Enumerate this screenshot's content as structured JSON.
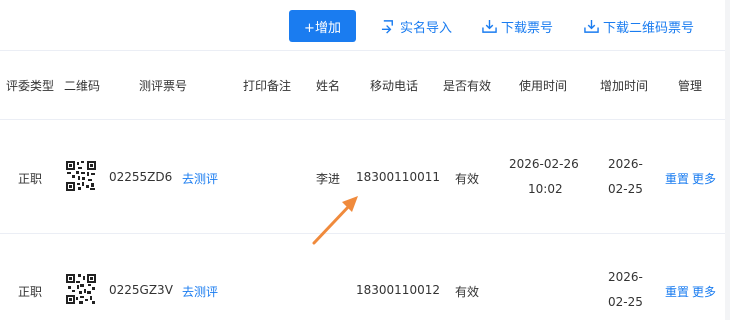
{
  "toolbar": {
    "add_label": "+增加",
    "import_label": "实名导入",
    "download_ticket_label": "下载票号",
    "download_qr_label": "下载二维码票号"
  },
  "table": {
    "headers": [
      "评委类型",
      "二维码",
      "测评票号",
      "打印备注",
      "姓名",
      "移动电话",
      "是否有效",
      "使用时间",
      "增加时间",
      "管理"
    ],
    "rows": [
      {
        "type": "正职",
        "ticket": "02255ZD6",
        "go_eval": "去测评",
        "remark": "",
        "name": "李进",
        "phone": "18300110011",
        "valid": "有效",
        "use_time_line1": "2026-02-26",
        "use_time_line2": "10:02",
        "add_time_line1": "2026-",
        "add_time_line2": "02-25",
        "reset": "重置",
        "more": "更多"
      },
      {
        "type": "正职",
        "ticket": "0225GZ3V",
        "go_eval": "去测评",
        "remark": "",
        "name": "",
        "phone": "18300110012",
        "valid": "有效",
        "use_time_line1": "",
        "use_time_line2": "",
        "add_time_line1": "2026-",
        "add_time_line2": "02-25",
        "reset": "重置",
        "more": "更多"
      }
    ]
  },
  "colors": {
    "accent": "#1a7cf0",
    "arrow": "#f08a3c",
    "border": "#ebeef5"
  }
}
